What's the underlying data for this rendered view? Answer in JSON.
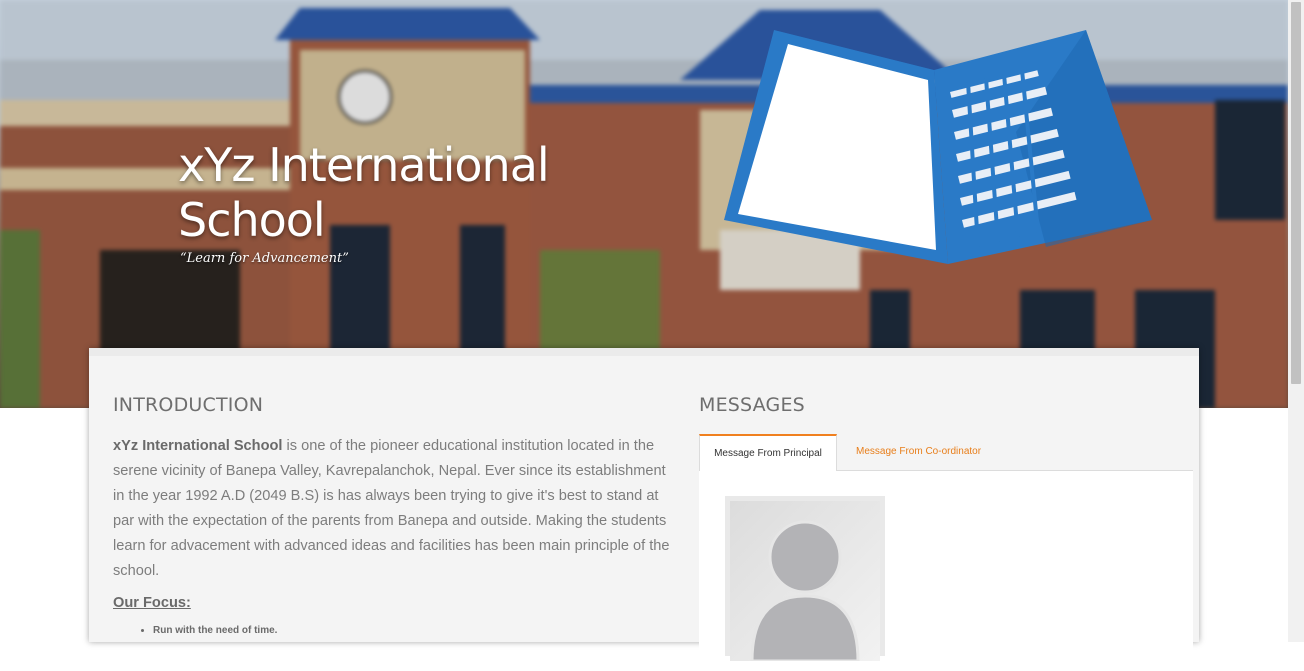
{
  "hero": {
    "title": "xYz International School",
    "tagline": "“Learn for Advancement”",
    "logo_icon": "laptop-logo-icon",
    "colors": {
      "logo_blue": "#2a7ac7",
      "screen": "#ffffff"
    }
  },
  "introduction": {
    "heading": "INTRODUCTION",
    "school_name": "xYz International School",
    "body": " is one of the pioneer educational institution located in the serene vicinity of Banepa Valley, Kavrepalanchok, Nepal. Ever since its establishment in the year 1992 A.D (2049 B.S) is has always been trying to give it's best to stand at par with the expectation of the parents from Banepa and outside. Making the students learn for advacement with advanced ideas and facilities has been main principle of the school.",
    "focus_heading": "Our Focus:",
    "focus_items": [
      "Run with the need of time."
    ]
  },
  "messages": {
    "heading": "MESSAGES",
    "tabs": [
      {
        "label": "Message From Principal",
        "active": true
      },
      {
        "label": "Message From Co-ordinator",
        "active": false
      }
    ],
    "avatar_icon": "person-placeholder-icon",
    "accent_color": "#f0801f"
  }
}
